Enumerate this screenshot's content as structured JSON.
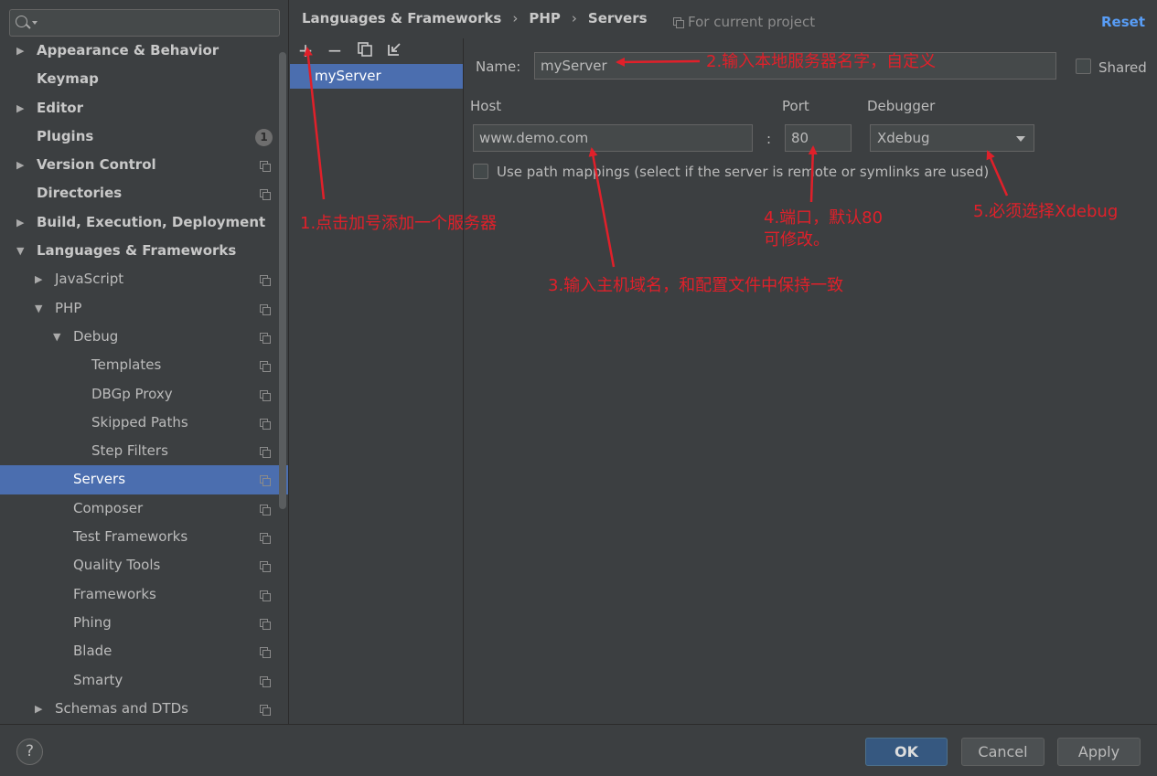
{
  "sidebar": {
    "search_placeholder": "",
    "items": [
      {
        "label": "Appearance & Behavior",
        "level": 0,
        "arrow": "▶",
        "bold": true
      },
      {
        "label": "Keymap",
        "level": 0,
        "arrow": "",
        "bold": true
      },
      {
        "label": "Editor",
        "level": 0,
        "arrow": "▶",
        "bold": true
      },
      {
        "label": "Plugins",
        "level": 0,
        "arrow": "",
        "bold": true,
        "badge": "1"
      },
      {
        "label": "Version Control",
        "level": 0,
        "arrow": "▶",
        "bold": true,
        "copy": true
      },
      {
        "label": "Directories",
        "level": 0,
        "arrow": "",
        "bold": true,
        "copy": true
      },
      {
        "label": "Build, Execution, Deployment",
        "level": 0,
        "arrow": "▶",
        "bold": true
      },
      {
        "label": "Languages & Frameworks",
        "level": 0,
        "arrow": "▼",
        "bold": true
      },
      {
        "label": "JavaScript",
        "level": 1,
        "arrow": "▶",
        "copy": true
      },
      {
        "label": "PHP",
        "level": 1,
        "arrow": "▼",
        "copy": true
      },
      {
        "label": "Debug",
        "level": 2,
        "arrow": "▼",
        "copy": true
      },
      {
        "label": "Templates",
        "level": 3,
        "arrow": "",
        "copy": true
      },
      {
        "label": "DBGp Proxy",
        "level": 3,
        "arrow": "",
        "copy": true
      },
      {
        "label": "Skipped Paths",
        "level": 3,
        "arrow": "",
        "copy": true
      },
      {
        "label": "Step Filters",
        "level": 3,
        "arrow": "",
        "copy": true
      },
      {
        "label": "Servers",
        "level": 2,
        "arrow": "",
        "copy": true,
        "selected": true
      },
      {
        "label": "Composer",
        "level": 2,
        "arrow": "",
        "copy": true
      },
      {
        "label": "Test Frameworks",
        "level": 2,
        "arrow": "",
        "copy": true
      },
      {
        "label": "Quality Tools",
        "level": 2,
        "arrow": "",
        "copy": true
      },
      {
        "label": "Frameworks",
        "level": 2,
        "arrow": "",
        "copy": true
      },
      {
        "label": "Phing",
        "level": 2,
        "arrow": "",
        "copy": true
      },
      {
        "label": "Blade",
        "level": 2,
        "arrow": "",
        "copy": true
      },
      {
        "label": "Smarty",
        "level": 2,
        "arrow": "",
        "copy": true
      },
      {
        "label": "Schemas and DTDs",
        "level": 1,
        "arrow": "▶",
        "copy": true
      }
    ]
  },
  "header": {
    "breadcrumb": [
      "Languages & Frameworks",
      "PHP",
      "Servers"
    ],
    "separator": "›",
    "scope_text": "For current project",
    "reset_label": "Reset"
  },
  "server_panel": {
    "toolbar": {
      "add": "+",
      "remove": "−"
    },
    "servers": [
      "myServer"
    ]
  },
  "form": {
    "name_label": "Name:",
    "name_value": "myServer",
    "shared_label": "Shared",
    "host_label": "Host",
    "host_value": "www.demo.com",
    "colon": ":",
    "port_label": "Port",
    "port_value": "80",
    "debugger_label": "Debugger",
    "debugger_value": "Xdebug",
    "path_mappings_label": "Use path mappings (select if the server is remote or symlinks are used)"
  },
  "annotations": {
    "a1": "1.点击加号添加一个服务器",
    "a2": "2.输入本地服务器名字，自定义",
    "a3": "3.输入主机域名，和配置文件中保持一致",
    "a4_line1": "4.端口，默认80",
    "a4_line2": "可修改。",
    "a5": "5.必须选择Xdebug",
    "color": "#e0202a"
  },
  "footer": {
    "help": "?",
    "ok": "OK",
    "cancel": "Cancel",
    "apply": "Apply"
  },
  "colors": {
    "background": "#3c3f41",
    "selection": "#4b6eaf",
    "link": "#589df6",
    "primary_button": "#365880"
  }
}
